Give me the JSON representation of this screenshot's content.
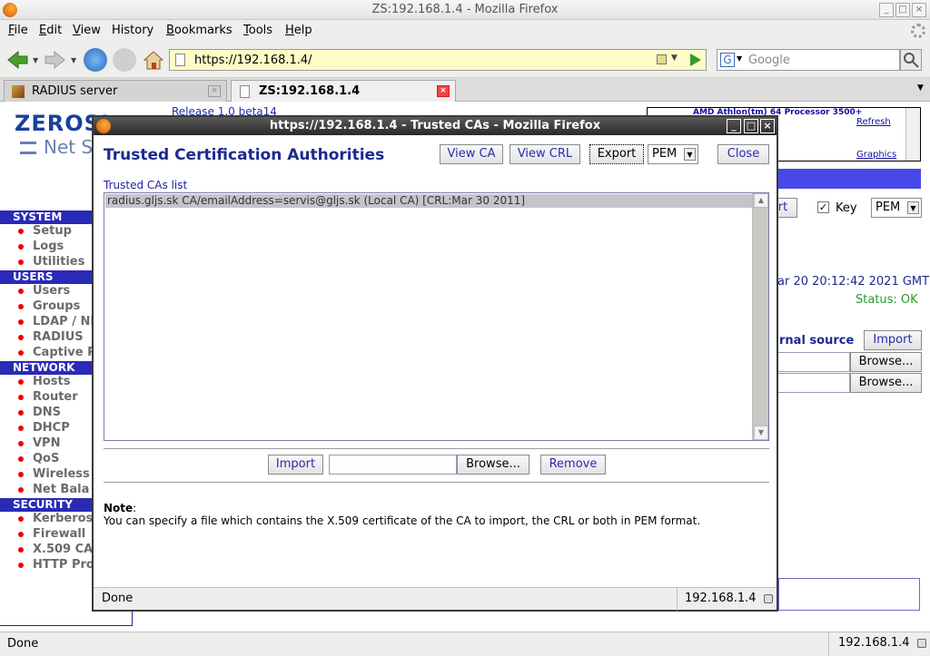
{
  "browser": {
    "window_title": "ZS:192.168.1.4 - Mozilla Firefox",
    "menu": [
      "File",
      "Edit",
      "View",
      "History",
      "Bookmarks",
      "Tools",
      "Help"
    ],
    "menu_keys": [
      "F",
      "E",
      "V",
      "s",
      "B",
      "T",
      "H"
    ],
    "url": "https://192.168.1.4/",
    "search_placeholder": "Google",
    "tabs": [
      {
        "label": "RADIUS server",
        "active": false
      },
      {
        "label": "ZS:192.168.1.4",
        "active": true
      }
    ],
    "status": "Done",
    "status_host": "192.168.1.4"
  },
  "page": {
    "logo_top": "ZEROSI",
    "logo_bottom": "Net S",
    "release": "Release 1.0 beta14",
    "cpu": "AMD Athlon(tm) 64 Processor 3500+",
    "refresh": "Refresh",
    "graphics": "Graphics",
    "sections": [
      {
        "title": "SYSTEM",
        "items": [
          "Setup",
          "Logs",
          "Utilities"
        ]
      },
      {
        "title": "USERS",
        "items": [
          "Users",
          "Groups",
          "LDAP / NI",
          "RADIUS",
          "Captive P"
        ]
      },
      {
        "title": "NETWORK",
        "items": [
          "Hosts",
          "Router",
          "DNS",
          "DHCP",
          "VPN",
          "QoS",
          "Wireless",
          "Net Bala"
        ]
      },
      {
        "title": "SECURITY",
        "items": [
          "Kerberos",
          "Firewall",
          "X.509 CA",
          "HTTP Pro"
        ]
      }
    ],
    "export_partial": "rt",
    "key_label": "Key",
    "key_format": "PEM",
    "date_text": "ar 20 20:12:42 2021 GMT",
    "status_text": "Status: OK",
    "external_source_label": "rnal source",
    "import_label": "Import",
    "browse_label_1": "Browse...",
    "browse_label_2": "Browse..."
  },
  "dialog": {
    "window_title": "https://192.168.1.4 - Trusted CAs - Mozilla Firefox",
    "heading": "Trusted Certification Authorities",
    "buttons": {
      "view_ca": "View CA",
      "view_crl": "View CRL",
      "export": "Export",
      "format": "PEM",
      "close": "Close"
    },
    "list_label": "Trusted CAs list",
    "ca_entries": [
      "radius.gljs.sk CA/emailAddress=servis@gljs.sk  (Local CA)  [CRL:Mar 30 2011]"
    ],
    "import_label": "Import",
    "browse_label": "Browse...",
    "remove_label": "Remove",
    "note_title": "Note",
    "note_text": "You can specify a file which contains the X.509 certificate of the CA to import, the CRL or both in PEM format.",
    "status": "Done",
    "status_host": "192.168.1.4"
  }
}
